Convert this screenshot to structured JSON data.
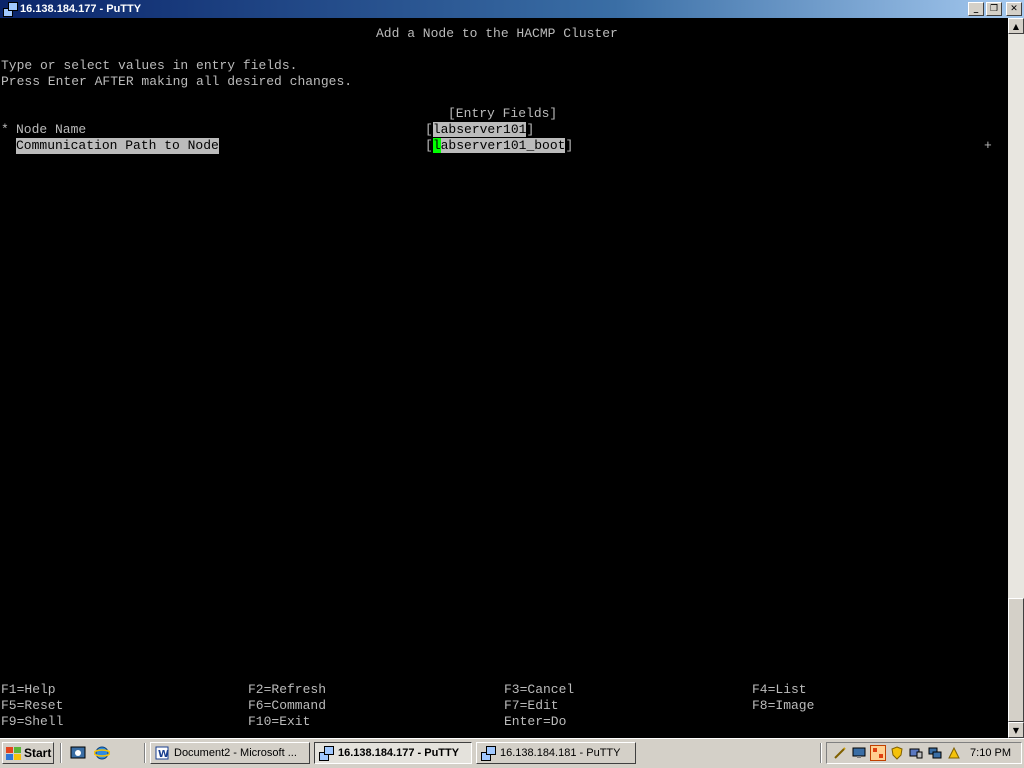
{
  "window": {
    "title": "16.138.184.177 - PuTTY",
    "buttons": {
      "minimize": "_",
      "maximize": "❐",
      "close": "✕"
    }
  },
  "terminal": {
    "heading": "Add a Node to the HACMP Cluster",
    "instructions": [
      "Type or select values in entry fields.",
      "Press Enter AFTER making all desired changes."
    ],
    "entry_fields_header": "[Entry Fields]",
    "fields": [
      {
        "marker": "*",
        "label": "Node Name",
        "value": "labserver101",
        "list_marker": ""
      },
      {
        "marker": "",
        "label": "Communication Path to Node",
        "value": "labserver101_boot",
        "list_marker": "+"
      }
    ],
    "bracket_open": "[",
    "bracket_close": "]",
    "function_keys": [
      [
        "F1=Help",
        "F2=Refresh",
        "F3=Cancel",
        "F4=List"
      ],
      [
        "F5=Reset",
        "F6=Command",
        "F7=Edit",
        "F8=Image"
      ],
      [
        "F9=Shell",
        "F10=Exit",
        "Enter=Do",
        ""
      ]
    ]
  },
  "taskbar": {
    "start_label": "Start",
    "tasks": [
      {
        "label": "Document2 - Microsoft ...",
        "active": false,
        "icon": "word-icon"
      },
      {
        "label": "16.138.184.177 - PuTTY",
        "active": true,
        "icon": "putty-icon"
      },
      {
        "label": "16.138.184.181 - PuTTY",
        "active": false,
        "icon": "putty-icon"
      }
    ],
    "clock": "7:10 PM"
  }
}
